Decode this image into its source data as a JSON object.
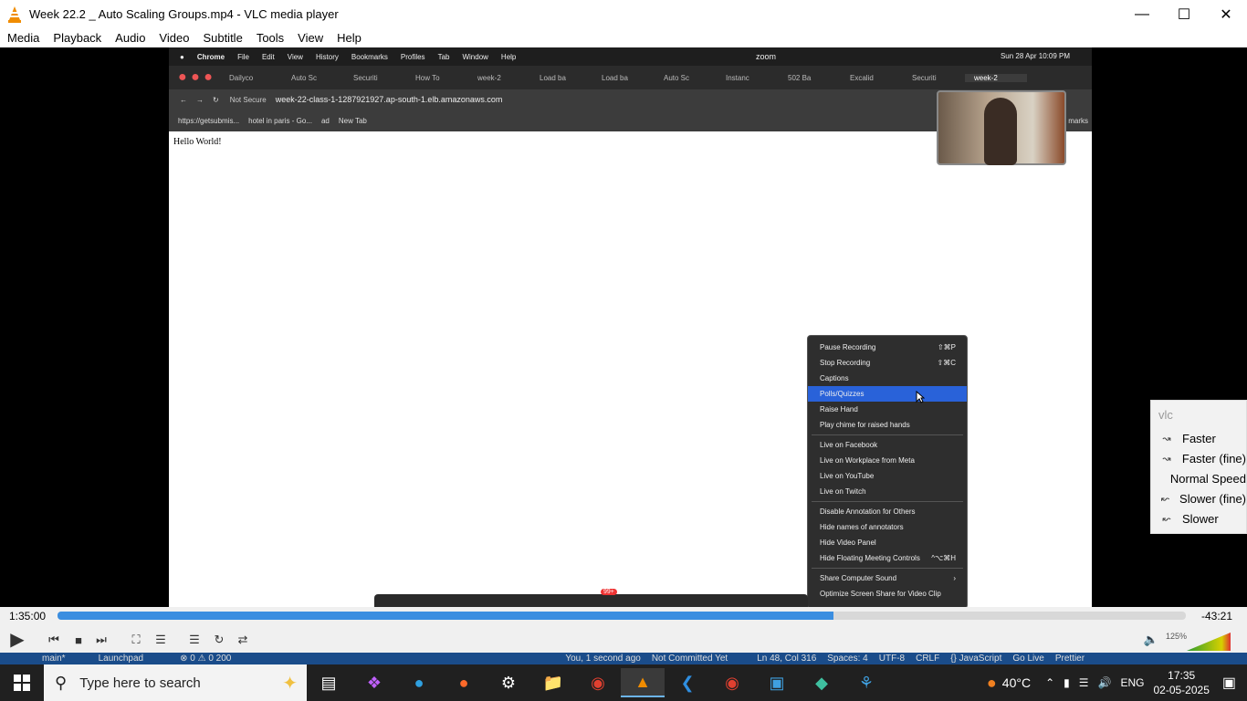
{
  "window": {
    "title": "Week 22.2 _ Auto Scaling Groups.mp4 - VLC media player"
  },
  "menu": [
    "Media",
    "Playback",
    "Audio",
    "Video",
    "Subtitle",
    "Tools",
    "View",
    "Help"
  ],
  "video_content": {
    "mac_menu": [
      "Chrome",
      "File",
      "Edit",
      "View",
      "History",
      "Bookmarks",
      "Profiles",
      "Tab",
      "Window",
      "Help"
    ],
    "mac_status": "zoom",
    "mac_clock": "Sun 28 Apr  10:09 PM",
    "tabs": [
      "Dailyco",
      "Auto Sc",
      "Securiti",
      "How To",
      "week-2",
      "Load ba",
      "Load ba",
      "Auto Sc",
      "Instanc",
      "502 Ba",
      "Excalid",
      "Securiti",
      "week-2"
    ],
    "not_secure": "Not Secure",
    "url": "week-22-class-1-1287921927.ap-south-1.elb.amazonaws.com",
    "bookmarks": [
      "https://getsubmis...",
      "hotel in paris - Go...",
      "ad",
      "New Tab"
    ],
    "bookmarks_right": "marks",
    "page_text": "Hello World!",
    "context_menu": [
      {
        "label": "Pause Recording",
        "shortcut": "⇧⌘P"
      },
      {
        "label": "Stop Recording",
        "shortcut": "⇧⌘C"
      },
      {
        "label": "Captions",
        "shortcut": ""
      },
      {
        "label": "Polls/Quizzes",
        "shortcut": "",
        "highlighted": true
      },
      {
        "label": "Raise Hand",
        "shortcut": ""
      },
      {
        "label": "Play chime for raised hands",
        "shortcut": ""
      },
      {
        "sep": true
      },
      {
        "label": "Live on Facebook",
        "shortcut": ""
      },
      {
        "label": "Live on Workplace from Meta",
        "shortcut": ""
      },
      {
        "label": "Live on YouTube",
        "shortcut": ""
      },
      {
        "label": "Live on Twitch",
        "shortcut": ""
      },
      {
        "sep": true
      },
      {
        "label": "Disable Annotation for Others",
        "shortcut": ""
      },
      {
        "label": "Hide names of annotators",
        "shortcut": ""
      },
      {
        "label": "Hide Video Panel",
        "shortcut": ""
      },
      {
        "label": "Hide Floating Meeting Controls",
        "shortcut": "^⌥⌘H"
      },
      {
        "sep": true
      },
      {
        "label": "Share Computer Sound",
        "shortcut": "›"
      },
      {
        "label": "Optimize Screen Share for Video Clip",
        "shortcut": ""
      }
    ],
    "zoom_badge": "99+"
  },
  "speed_popup": {
    "header": "vlc",
    "items": [
      {
        "label": "Faster",
        "icon": "faster-icon"
      },
      {
        "label": "Faster (fine)",
        "icon": "faster-fine-icon"
      },
      {
        "label": "Normal Speed",
        "icon": ""
      },
      {
        "label": "Slower (fine)",
        "icon": "slower-fine-icon"
      },
      {
        "label": "Slower",
        "icon": "slower-icon"
      }
    ]
  },
  "playback": {
    "elapsed": "1:35:00",
    "remaining": "-43:21",
    "progress": 0.688,
    "volume_label": "125%",
    "volume": 1.25
  },
  "vscode_status": [
    "main*",
    "Launchpad",
    "⊗ 0 ⚠ 0  200",
    "You, 1 second ago",
    "Not Committed Yet",
    "Ln 48, Col 316",
    "Spaces: 4",
    "UTF-8",
    "CRLF",
    "{} JavaScript",
    "Go Live",
    "Prettier"
  ],
  "taskbar": {
    "search_placeholder": "Type here to search",
    "weather": "40°C",
    "lang": "ENG",
    "time": "17:35",
    "date": "02-05-2025"
  },
  "colors": {
    "accent": "#3b8ee0",
    "highlight": "#2962d9",
    "vlc_orange": "#f08c00"
  }
}
